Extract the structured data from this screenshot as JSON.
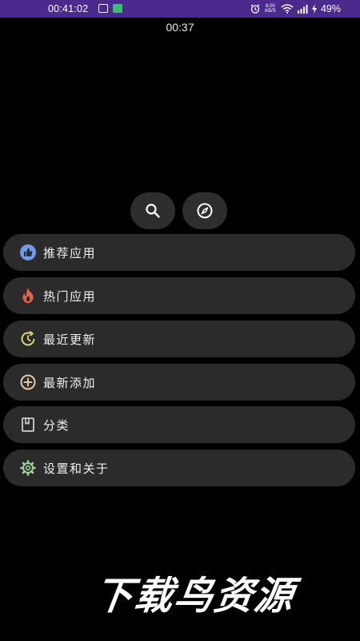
{
  "status_bar": {
    "time": "00:41:02",
    "net_speed_value": "6.00",
    "net_speed_unit": "KB/S",
    "battery": "49%",
    "icons": [
      "mail-icon",
      "message-icon",
      "alarm-icon",
      "vibrate-icon",
      "wifi-icon",
      "signal-icon",
      "charging-icon"
    ],
    "background_color": "#4a2a8c"
  },
  "timer": "00:37",
  "actions": {
    "search_icon": "search-icon",
    "explore_icon": "compass-icon"
  },
  "menu": {
    "items": [
      {
        "label": "推荐应用",
        "icon": "thumbs-up-icon",
        "icon_color": "#6f9bea"
      },
      {
        "label": "热门应用",
        "icon": "fire-icon",
        "icon_color": "#e0634a"
      },
      {
        "label": "最近更新",
        "icon": "refresh-clock-icon",
        "icon_color": "#d8d77a"
      },
      {
        "label": "最新添加",
        "icon": "add-circle-icon",
        "icon_color": "#e6c8a8"
      },
      {
        "label": "分类",
        "icon": "bookmark-icon",
        "icon_color": "#cfcfcf"
      },
      {
        "label": "设置和关于",
        "icon": "settings-icon",
        "icon_color": "#9fd59b"
      }
    ]
  },
  "watermark": "下载鸟资源",
  "colors": {
    "background": "#000000",
    "item_background": "#2b2b2b",
    "round_button_background": "#2e2e2e",
    "text": "#f0f0f0"
  }
}
